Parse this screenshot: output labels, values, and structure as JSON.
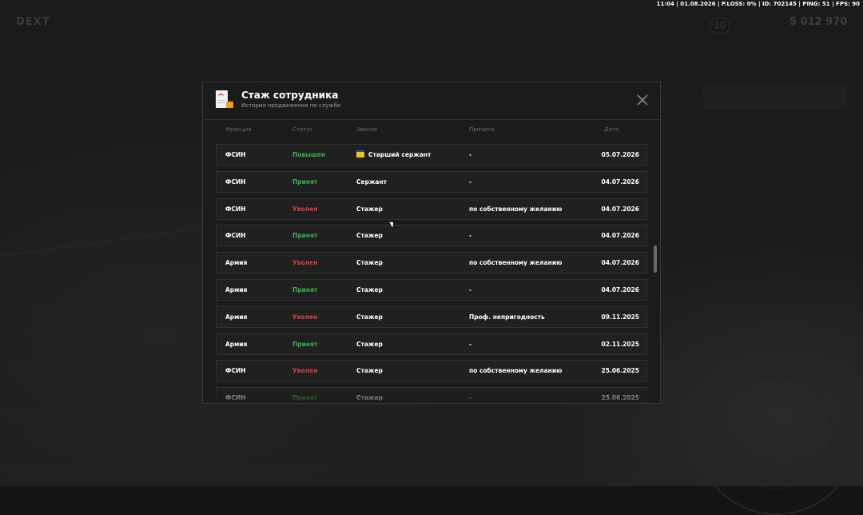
{
  "hud": {
    "text": "11:04 | 01.08.2026 | P.LOSS: 0% | ID: 702145 | PING: 51 | FPS: 90"
  },
  "background": {
    "logo": "DEXT",
    "money": "5 012 970",
    "level": "10"
  },
  "modal": {
    "title": "Стаж сотрудника",
    "subtitle": "История продвижения по службе",
    "close_icon": "close-icon",
    "doc_icon": "document-icon"
  },
  "columns": {
    "fraction": "Фракция",
    "status": "Статус",
    "rank": "Звание",
    "reason": "Причина",
    "date": "Дата"
  },
  "status_colors": {
    "promoted": "#37b34a",
    "hired": "#37b34a",
    "fired": "#d64040"
  },
  "rows": [
    {
      "fraction": "ФСИН",
      "status": "Повышен",
      "status_type": "up",
      "rank": "Старший сержант",
      "rank_icon": true,
      "reason": "-",
      "date": "05.07.2026"
    },
    {
      "fraction": "ФСИН",
      "status": "Принят",
      "status_type": "in",
      "rank": "Сержант",
      "rank_icon": false,
      "reason": "-",
      "date": "04.07.2026"
    },
    {
      "fraction": "ФСИН",
      "status": "Уволен",
      "status_type": "out",
      "rank": "Стажер",
      "rank_icon": false,
      "reason": "по собственному желанию",
      "date": "04.07.2026"
    },
    {
      "fraction": "ФСИН",
      "status": "Принят",
      "status_type": "in",
      "rank": "Стажер",
      "rank_icon": false,
      "reason": "-",
      "date": "04.07.2026"
    },
    {
      "fraction": "Армия",
      "status": "Уволен",
      "status_type": "out",
      "rank": "Стажер",
      "rank_icon": false,
      "reason": "по собственному желанию",
      "date": "04.07.2026"
    },
    {
      "fraction": "Армия",
      "status": "Принят",
      "status_type": "in",
      "rank": "Стажер",
      "rank_icon": false,
      "reason": "-",
      "date": "04.07.2026"
    },
    {
      "fraction": "Армия",
      "status": "Уволен",
      "status_type": "out",
      "rank": "Стажер",
      "rank_icon": false,
      "reason": "Проф. непригодность",
      "date": "09.11.2025"
    },
    {
      "fraction": "Армия",
      "status": "Принят",
      "status_type": "in",
      "rank": "Стажер",
      "rank_icon": false,
      "reason": "-",
      "date": "02.11.2025"
    },
    {
      "fraction": "ФСИН",
      "status": "Уволен",
      "status_type": "out",
      "rank": "Стажер",
      "rank_icon": false,
      "reason": "по собственному желанию",
      "date": "25.06.2025"
    },
    {
      "fraction": "ФСИН",
      "status": "Принят",
      "status_type": "in",
      "rank": "Стажер",
      "rank_icon": false,
      "reason": "-",
      "date": "25.06.2025"
    }
  ]
}
